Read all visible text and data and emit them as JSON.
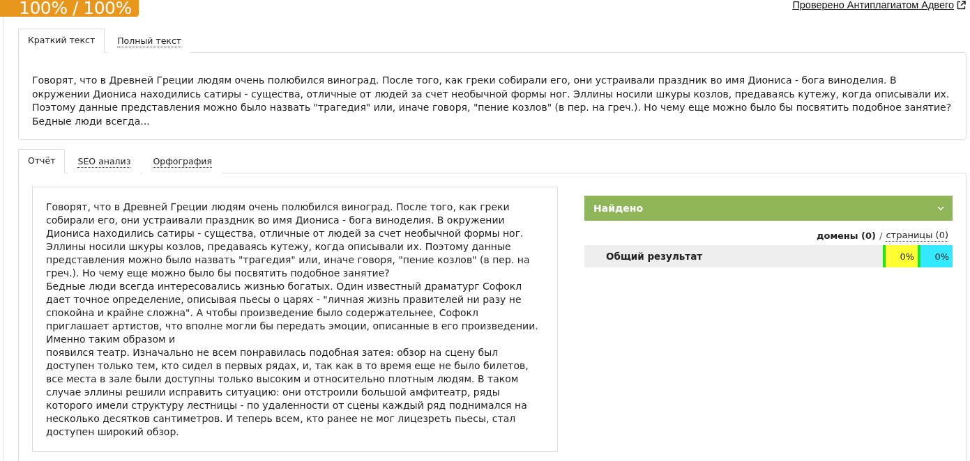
{
  "score_badge": {
    "text": "100% / 100%"
  },
  "verified_link": {
    "text": "Проверено Антиплагиатом Адвего"
  },
  "text_tabs": [
    {
      "label": "Краткий текст",
      "selected": true
    },
    {
      "label": "Полный текст",
      "selected": false
    }
  ],
  "short_text": "Говорят, что в Древней Греции людям очень полюбился виноград. После того, как греки собирали его, они устраивали праздник во имя Диониса - бога виноделия. В окружении Диониса находились сатиры - существа, отличные от людей за счет необычной формы ног. Эллины носили шкуры козлов, предаваясь кутежу, когда описывали их. Поэтому данные представления можно было назвать \"трагедия\" или, иначе говоря, \"пение козлов\" (в пер. на греч.). Но чему еще можно было бы посвятить подобное занятие? Бедные люди всегда...",
  "report_tabs": [
    {
      "label": "Отчёт",
      "selected": true
    },
    {
      "label": "SEO анализ",
      "selected": false
    },
    {
      "label": "Орфография",
      "selected": false
    }
  ],
  "report": {
    "paragraphs": [
      "Говорят, что в Древней Греции людям очень полюбился виноград. После того, как греки собирали его, они устраивали праздник во имя Диониса - бога виноделия. В окружении Диониса находились сатиры - существа, отличные от людей за счет необычной формы ног. Эллины носили шкуры козлов, предаваясь кутежу, когда описывали их. Поэтому данные представления можно было назвать \"трагедия\" или, иначе говоря, \"пение козлов\" (в пер. на греч.). Но чему еще можно было бы посвятить подобное занятие?",
      "Бедные люди всегда интересовались жизнью богатых. Один известный драматург Софокл дает точное определение, описывая пьесы о царях - \"личная жизнь правителей ни разу не спокойна и крайне сложна\". А чтобы произведение было содержательнее, Софокл приглашает артистов, что вполне могли бы передать эмоции, описанные в его произведении. Именно таким образом и",
      "появился театр. Изначально не всем понравилась подобная затея: обзор на сцену был доступен только тем, кто сидел в первых рядах, и, так как в то время еще не было билетов, все места в зале были доступны только высоким и относительно плотным людям. В таком случае эллины решили исправить ситуацию: они отстроили большой амфитеатр, ряды которого имели структуру лестницы - по удаленности от сцены каждый ряд поднимался на несколько десятков сантиметров. И теперь всем, кто ранее не мог лицезреть пьесы, стал доступен широкий обзор."
    ],
    "found": {
      "title": "Найдено",
      "view_modes": [
        {
          "label": "домены (0)",
          "selected": true
        },
        {
          "label": "страницы (0)",
          "selected": false
        }
      ],
      "separator": "/",
      "result": {
        "label": "Общий результат",
        "cells": [
          {
            "text": "0%",
            "color": "#ffff33"
          },
          {
            "text": "0%",
            "color": "#33e8ff"
          }
        ]
      }
    }
  }
}
